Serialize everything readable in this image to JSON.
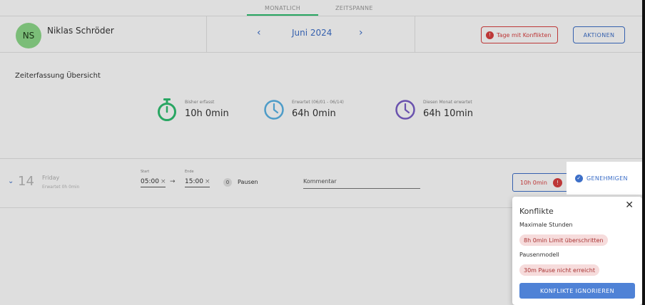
{
  "tabs": {
    "monthly": "MONATLICH",
    "period": "ZEITSPANNE"
  },
  "user": {
    "initials": "NS",
    "name": "Niklas Schröder"
  },
  "period_nav": {
    "prev_icon": "‹",
    "month": "Juni 2024",
    "next_icon": "›"
  },
  "header_actions": {
    "conflicts_count": "!",
    "conflicts_label": "Tage mit Konflikten",
    "actions_label": "AKTIONEN"
  },
  "overview": {
    "title": "Zeiterfassung Übersicht",
    "stats": [
      {
        "label": "Bisher erfasst",
        "value": "10h 0min",
        "icon": "stopwatch-icon",
        "color": "#2fbf71"
      },
      {
        "label": "Erwartet (06/01 - 06/14)",
        "value": "64h 0min",
        "icon": "clock-icon",
        "color": "#5ab4e6"
      },
      {
        "label": "Diesen Monat erwartet",
        "value": "64h 10min",
        "icon": "clock-icon",
        "color": "#7a5fc8"
      }
    ]
  },
  "day_row": {
    "chevron": "⌄",
    "day_number": "14",
    "day_name": "Friday",
    "expected": "Erwartet 0h 0min",
    "start_label": "Start",
    "start_value": "05:00",
    "end_label": "Ende",
    "end_value": "15:00",
    "clear_icon": "×",
    "arrow": "→",
    "pause_count": "0",
    "pause_label": "Pausen",
    "comment_placeholder": "Kommentar",
    "hours": "10h 0min",
    "hours_badge": "!",
    "approve_label": "GENEHMIGEN"
  },
  "popover": {
    "title": "Konflikte",
    "close": "✕",
    "sections": [
      {
        "heading": "Maximale Stunden",
        "chip": "8h 0min Limit überschritten"
      },
      {
        "heading": "Pausenmodell",
        "chip": "30m Pause nicht erreicht"
      }
    ],
    "ignore_label": "KONFLIKTE IGNORIEREN"
  },
  "colors": {
    "accent": "#3d6fc8",
    "success": "#2fbf71",
    "danger": "#d94040"
  }
}
